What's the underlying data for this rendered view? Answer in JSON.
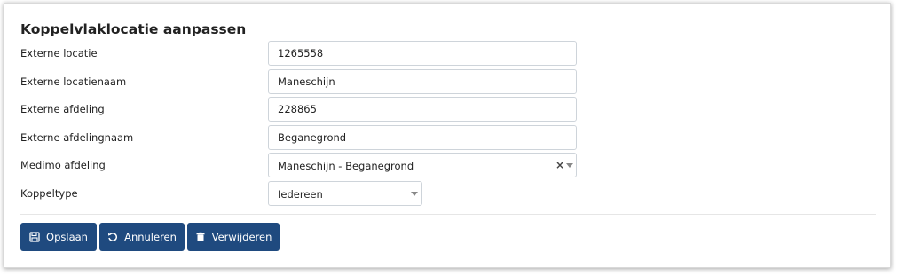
{
  "form": {
    "title": "Koppelvlaklocatie aanpassen",
    "fields": [
      {
        "label": "Externe locatie",
        "value": "1265558"
      },
      {
        "label": "Externe locatienaam",
        "value": "Maneschijn"
      },
      {
        "label": "Externe afdeling",
        "value": "228865"
      },
      {
        "label": "Externe afdelingnaam",
        "value": "Beganegrond"
      }
    ],
    "medimo_afdeling": {
      "label": "Medimo afdeling",
      "value": "Maneschijn - Beganegrond",
      "clear": "×"
    },
    "koppeltype": {
      "label": "Koppeltype",
      "value": "Iedereen"
    }
  },
  "actions": {
    "save_label": "Opslaan",
    "cancel_label": "Annuleren",
    "delete_label": "Verwijderen"
  },
  "icons": {
    "save": "floppy-disk-icon",
    "cancel": "undo-icon",
    "delete": "trash-icon"
  },
  "colors": {
    "button_bg": "#1f4a7f",
    "button_text": "#ffffff"
  }
}
